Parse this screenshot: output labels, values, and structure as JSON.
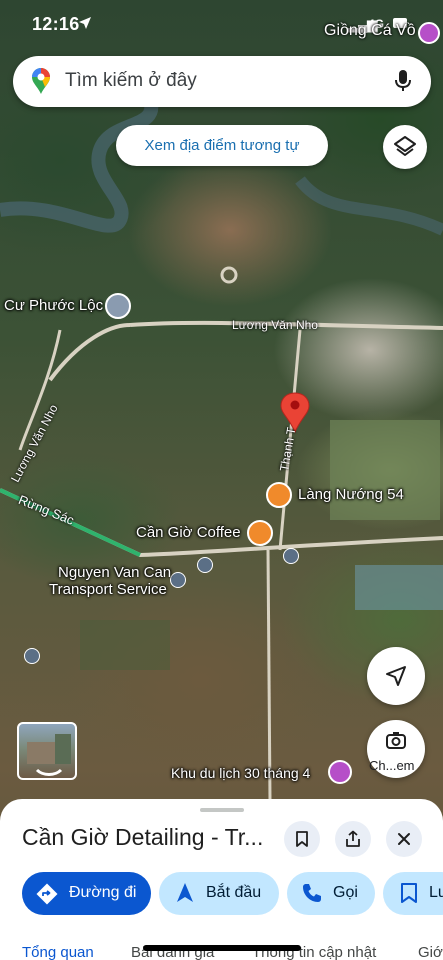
{
  "status_bar": {
    "time": "12:16",
    "network": "4G"
  },
  "search": {
    "placeholder": "Tìm kiếm ở đây"
  },
  "similar_chip": {
    "label": "Xem địa điểm tương tự"
  },
  "map_labels": {
    "giong_ca_vo": "Giồng Cá Vồ",
    "cu_phuoc_loc": "Cư Phước Lộc",
    "luong_van_nho_1": "Lương Văn Nho",
    "luong_van_nho_2": "Lương Văn Nho",
    "rung_sac": "Rừng Sác",
    "thanh_thai": "Thạnh T",
    "lang_nuong": "Làng Nướng 54",
    "can_gio_coffee": "Cần Giờ Coffee",
    "nguyen_van_can_1": "Nguyen Van Can",
    "nguyen_van_can_2": "Transport Service",
    "khu_du_lich": "Khu du lịch 30 tháng 4",
    "ch_label": "Ch...em"
  },
  "place": {
    "title": "Cần Giờ Detailing - Tr..."
  },
  "actions": [
    {
      "label": "Đường đi",
      "icon": "directions-icon"
    },
    {
      "label": "Bắt đầu",
      "icon": "navigation-arrow-icon"
    },
    {
      "label": "Gọi",
      "icon": "phone-icon"
    },
    {
      "label": "Lư",
      "icon": "bookmark-icon"
    }
  ],
  "tabs": [
    "Tổng quan",
    "Bài đánh giá",
    "Thông tin cập nhật",
    "Giới"
  ],
  "colors": {
    "primary": "#0b57d0",
    "chip": "#c2e7ff",
    "pin": "#ea4335"
  }
}
